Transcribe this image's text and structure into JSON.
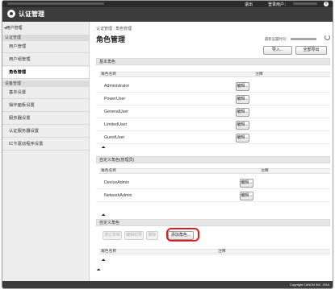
{
  "header": {
    "logout": "退出",
    "login_user_label": "登录用户：",
    "help": "?",
    "title": "认证管理"
  },
  "sidebar": {
    "back": "◂用户管理",
    "sections": [
      {
        "label": "认证管理",
        "items": [
          "用户管理",
          "用户组管理",
          "角色管理"
        ]
      },
      {
        "label": "设备管理",
        "items": [
          "基本设置",
          "操作面板设置",
          "服务器设置",
          "认证服务器设置",
          "IC卡驱动程序设置"
        ]
      }
    ],
    "active": "角色管理"
  },
  "main": {
    "breadcrumb": "认证管理 : 角色管理",
    "title": "角色管理",
    "last_updated_label": "最新设置时间：",
    "import_btn": "导入...",
    "export_btn": "全部导出",
    "base_section": "基本角色",
    "col_role_name": "角色名称",
    "col_comment": "注释",
    "base_roles": [
      "Administrator",
      "PowerUser",
      "GeneralUser",
      "LimitedUser",
      "GuestUser"
    ],
    "edit_btn": "编辑...",
    "custom_admin_section": "自定义角色(管理员)",
    "custom_admin_roles": [
      "DeviceAdmin",
      "NetworkAdmin"
    ],
    "custom_section": "自定义角色",
    "custom_toolbar": [
      "通过复制",
      "编辑权限",
      "删除",
      "添加角色..."
    ]
  },
  "footer": {
    "copyright": "Copyright CANON INC. 2016"
  },
  "colors": {
    "header": "#3c3c3c",
    "highlight": "#e01e1e",
    "sidebar": "#ededed"
  }
}
